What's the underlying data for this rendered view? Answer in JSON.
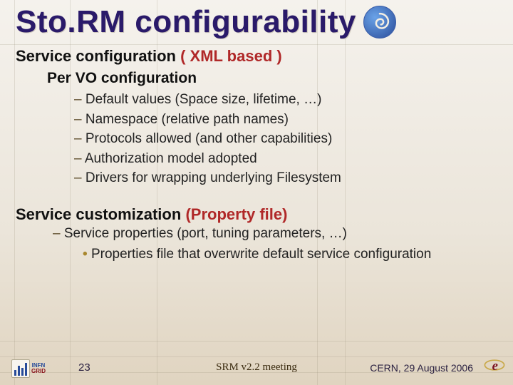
{
  "title": "Sto.RM configurability",
  "logo_name": "spiral-logo",
  "section1": {
    "heading": "Service configuration",
    "paren": "( XML based )",
    "sub": "Per VO configuration",
    "items": [
      "Default values (Space size, lifetime, …)",
      "Namespace (relative path names)",
      "Protocols allowed (and other capabilities)",
      "Authorization model adopted",
      "Drivers for wrapping underlying Filesystem"
    ]
  },
  "section2": {
    "heading": "Service customization",
    "paren": "(Property file)",
    "items": [
      "Service properties (port, tuning parameters, …)"
    ],
    "subitems": [
      "Properties file that overwrite default service configuration"
    ]
  },
  "footer": {
    "infn_label": "INFN",
    "grid_label": "GRID",
    "page": "23",
    "meeting": "SRM v2.2 meeting",
    "venue": "CERN, 29 August 2006"
  }
}
